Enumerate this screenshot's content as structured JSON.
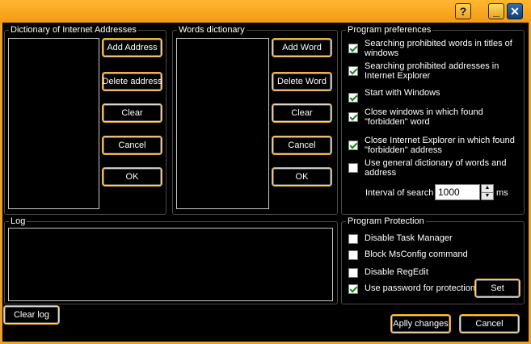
{
  "window": {
    "help_glyph": "?",
    "minimize_glyph": "_",
    "close_glyph": "✕",
    "accent_color": "#f0a020"
  },
  "internet_dictionary": {
    "legend": "Dictionary of Internet Addresses",
    "buttons": {
      "add": "Add  Address",
      "delete": "Delete address",
      "clear": "Clear",
      "cancel": "Cancel",
      "ok": "OK"
    }
  },
  "words_dictionary": {
    "legend": "Words dictionary",
    "buttons": {
      "add": "Add Word",
      "delete": "Delete Word",
      "clear": "Clear",
      "cancel": "Cancel",
      "ok": "OK"
    }
  },
  "preferences": {
    "legend": "Program preferences",
    "options": [
      {
        "label_1": "Searching prohibited words in titles of",
        "label_2": "windows",
        "checked": true
      },
      {
        "label_1": "Searching prohibited addresses in",
        "label_2": "Internet Explorer",
        "checked": true
      },
      {
        "label_1": "Start with Windows",
        "label_2": "",
        "checked": true
      },
      {
        "label_1": "Close windows in which found",
        "label_2": "\"forbidden\" word",
        "checked": true
      },
      {
        "label_1": "Close Internet Explorer in which found",
        "label_2": "\"forbidden\" address",
        "checked": true
      },
      {
        "label_1": "Use general dictionary of words and",
        "label_2": "address",
        "checked": false
      }
    ],
    "interval_label": "Interval of search",
    "interval_value": "1000",
    "interval_unit": "ms"
  },
  "log": {
    "legend": "Log",
    "clear_label": "Clear log"
  },
  "protection": {
    "legend": "Program Protection",
    "options": [
      {
        "label": "Disable Task Manager",
        "checked": false
      },
      {
        "label": "Block MsConfig command",
        "checked": false
      },
      {
        "label": "Disable RegEdit",
        "checked": false
      },
      {
        "label": "Use password for protection",
        "checked": true
      }
    ],
    "set_label": "Set"
  },
  "footer": {
    "apply_label": "Aplly changes",
    "cancel_label": "Cancel"
  }
}
